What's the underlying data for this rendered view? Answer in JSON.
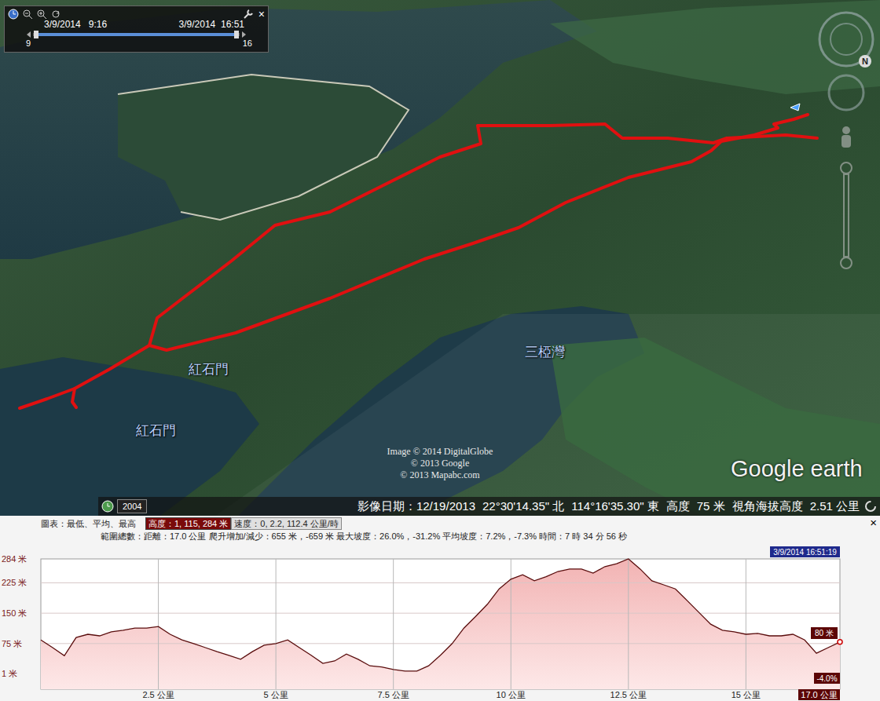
{
  "time_slider": {
    "start_time": "3/9/2014   9:16",
    "end_time": "3/9/2014  16:51",
    "start_tick": "9",
    "end_tick": "16",
    "start_level": 0,
    "end_level": 1,
    "close": "×"
  },
  "map": {
    "labels": [
      {
        "text": "紅石門"
      },
      {
        "text": "紅石門"
      },
      {
        "text": "三椏灣"
      }
    ],
    "attribution": [
      "Image © 2014 DigitalGlobe",
      "© 2013 Google",
      "© 2013 Mapabc.com"
    ],
    "logo": "Google earth",
    "compass": "N"
  },
  "status_bar": {
    "year": "2004",
    "items": [
      "影像日期：12/19/2013",
      "22°30'14.35\" 北",
      "114°16'35.30\" 東",
      "高度",
      "75 米",
      "視角海拔高度",
      "2.51 公里"
    ]
  },
  "profile": {
    "close": "×",
    "summary_label": "圖表：最低、平均、最高",
    "height_stats": "高度：1, 115, 284 米",
    "speed_stats": "速度：0, 2.2, 112.4 公里/時",
    "range_label": "範圍總數：",
    "range_stats": "距離：17.0 公里 爬升增加/減少：655 米，-659 米 最大坡度：26.0%，-31.2% 平均坡度：7.2%，-7.3% 時間：7 時 34 分 56 秒",
    "timestamp": "3/9/2014 16:51:19",
    "marker_height": "80 米",
    "marker_grade": "-4.0%",
    "end_distance": "17.0 公里",
    "y_ticks": [
      {
        "label": "284 米",
        "value": 284
      },
      {
        "label": "225 米",
        "value": 225
      },
      {
        "label": "150 米",
        "value": 150
      },
      {
        "label": "75 米",
        "value": 75
      },
      {
        "label": "1 米",
        "value": 1
      }
    ],
    "x_ticks": [
      {
        "label": "2.5 公里",
        "value": 2.5
      },
      {
        "label": "5 公里",
        "value": 5
      },
      {
        "label": "7.5 公里",
        "value": 7.5
      },
      {
        "label": "10 公里",
        "value": 10
      },
      {
        "label": "12.5 公里",
        "value": 12.5
      },
      {
        "label": "15 公里",
        "value": 15
      }
    ],
    "series": [
      {
        "name": "高度",
        "x_step": 0.25,
        "values": [
          84,
          65,
          45,
          90,
          98,
          94,
          104,
          108,
          113,
          113,
          117,
          98,
          84,
          75,
          65,
          55,
          46,
          36,
          55,
          71,
          75,
          84,
          65,
          46,
          26,
          32,
          49,
          36,
          20,
          17,
          11,
          7,
          7,
          20,
          46,
          75,
          113,
          142,
          172,
          210,
          234,
          245,
          230,
          240,
          253,
          259,
          259,
          249,
          265,
          272,
          284,
          259,
          230,
          220,
          210,
          181,
          152,
          123,
          108,
          104,
          98,
          100,
          94,
          94,
          98,
          84,
          51,
          65,
          79
        ]
      }
    ]
  }
}
